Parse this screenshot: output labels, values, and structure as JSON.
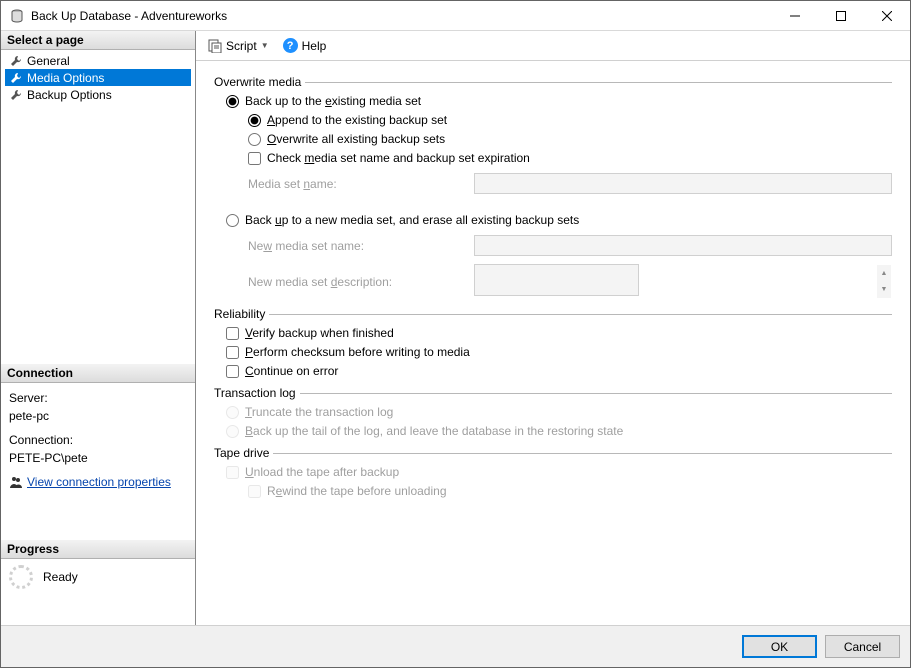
{
  "window": {
    "title": "Back Up Database - Adventureworks"
  },
  "sidebar": {
    "select_page_header": "Select a page",
    "pages": [
      {
        "label": "General",
        "selected": false
      },
      {
        "label": "Media Options",
        "selected": true
      },
      {
        "label": "Backup Options",
        "selected": false
      }
    ],
    "connection_header": "Connection",
    "server_label": "Server:",
    "server_value": "pete-pc",
    "connection_label": "Connection:",
    "connection_value": "PETE-PC\\pete",
    "view_props_link": "View connection properties",
    "progress_header": "Progress",
    "progress_status": "Ready"
  },
  "toolbar": {
    "script_label": "Script",
    "help_label": "Help"
  },
  "overwrite_media": {
    "group_label": "Overwrite media",
    "back_up_existing": "Back up to the existing media set",
    "append_existing": "Append to the existing backup set",
    "overwrite_all": "Overwrite all existing backup sets",
    "check_media": "Check media set name and backup set expiration",
    "media_set_name_label": "Media set name:",
    "media_set_name_value": "",
    "back_up_new": "Back up to a new media set, and erase all existing backup sets",
    "new_media_name_label": "New media set name:",
    "new_media_name_value": "",
    "new_media_desc_label": "New media set description:",
    "new_media_desc_value": ""
  },
  "reliability": {
    "group_label": "Reliability",
    "verify": "Verify backup when finished",
    "checksum": "Perform checksum before writing to media",
    "continue": "Continue on error"
  },
  "transaction_log": {
    "group_label": "Transaction log",
    "truncate": "Truncate the transaction log",
    "backup_tail": "Back up the tail of the log, and leave the database in the restoring state"
  },
  "tape_drive": {
    "group_label": "Tape drive",
    "unload": "Unload the tape after backup",
    "rewind": "Rewind the tape before unloading"
  },
  "buttons": {
    "ok": "OK",
    "cancel": "Cancel"
  },
  "underline": {
    "existing": "e",
    "AppendA": "A",
    "OverwriteO": "O",
    "check_m": "m",
    "name_n": "n",
    "new_u": "u",
    "new_name_w": "w",
    "new_desc_d": "d",
    "verify_V": "V",
    "checksum_P": "P",
    "continueC": "C",
    "truncateT": "T",
    "tail_B": "B",
    "unloadU": "U",
    "rewind_e": "e"
  }
}
